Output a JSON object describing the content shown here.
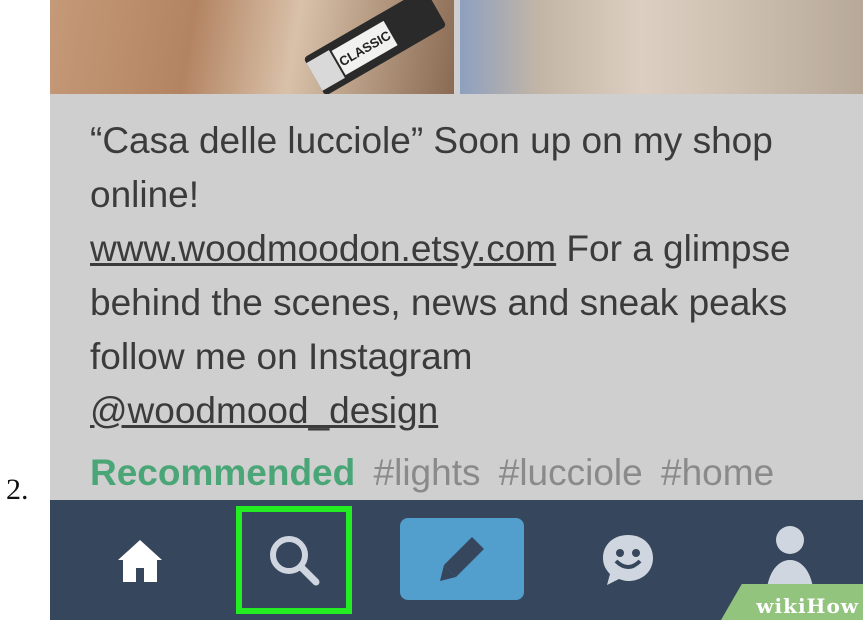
{
  "step_number": "2.",
  "post": {
    "text_before_link": "“Casa delle lucciole”  Soon up on my shop online!",
    "link": "www.woodmoodon.etsy.com",
    "text_after_link": "  For a glimpse behind the scenes, news and sneak peaks follow me on Instagram",
    "instagram_handle": "@woodmood_design",
    "tube_label": "CLASSIC"
  },
  "tags": {
    "recommended_label": "Recommended",
    "items": [
      "#lights",
      "#lucciole",
      "#home"
    ]
  },
  "tabbar": {
    "tabs": [
      {
        "name": "home",
        "icon": "home-icon"
      },
      {
        "name": "search",
        "icon": "search-icon",
        "highlighted": true
      },
      {
        "name": "compose",
        "icon": "pencil-icon"
      },
      {
        "name": "messages",
        "icon": "smiley-chat-icon"
      },
      {
        "name": "account",
        "icon": "person-icon"
      }
    ]
  },
  "colors": {
    "tabbar_bg": "#36465d",
    "compose_bg": "#529ecc",
    "highlight": "#22ee22",
    "recommended": "#4aa677"
  },
  "watermark": {
    "prefix": "wiki",
    "suffix": "How"
  }
}
